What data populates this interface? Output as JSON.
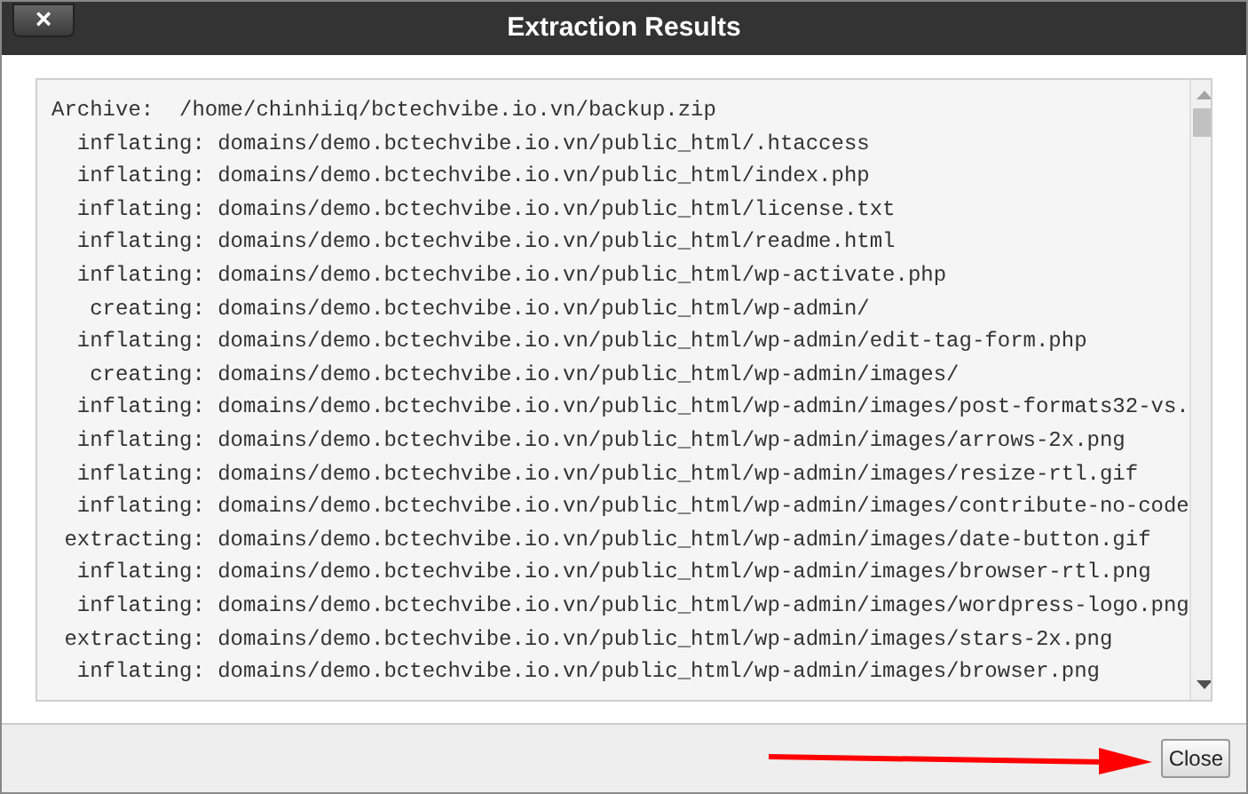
{
  "window": {
    "title": "Extraction Results",
    "close_glyph": "×"
  },
  "log": [
    {
      "kind": "archive",
      "label": "Archive:",
      "path": "/home/chinhiiq/bctechvibe.io.vn/backup.zip"
    },
    {
      "kind": "entry",
      "label": "inflating:",
      "path": "domains/demo.bctechvibe.io.vn/public_html/.htaccess"
    },
    {
      "kind": "entry",
      "label": "inflating:",
      "path": "domains/demo.bctechvibe.io.vn/public_html/index.php"
    },
    {
      "kind": "entry",
      "label": "inflating:",
      "path": "domains/demo.bctechvibe.io.vn/public_html/license.txt"
    },
    {
      "kind": "entry",
      "label": "inflating:",
      "path": "domains/demo.bctechvibe.io.vn/public_html/readme.html"
    },
    {
      "kind": "entry",
      "label": "inflating:",
      "path": "domains/demo.bctechvibe.io.vn/public_html/wp-activate.php"
    },
    {
      "kind": "entry",
      "label": "creating:",
      "path": "domains/demo.bctechvibe.io.vn/public_html/wp-admin/"
    },
    {
      "kind": "entry",
      "label": "inflating:",
      "path": "domains/demo.bctechvibe.io.vn/public_html/wp-admin/edit-tag-form.php"
    },
    {
      "kind": "entry",
      "label": "creating:",
      "path": "domains/demo.bctechvibe.io.vn/public_html/wp-admin/images/"
    },
    {
      "kind": "entry",
      "label": "inflating:",
      "path": "domains/demo.bctechvibe.io.vn/public_html/wp-admin/images/post-formats32-vs."
    },
    {
      "kind": "entry",
      "label": "inflating:",
      "path": "domains/demo.bctechvibe.io.vn/public_html/wp-admin/images/arrows-2x.png"
    },
    {
      "kind": "entry",
      "label": "inflating:",
      "path": "domains/demo.bctechvibe.io.vn/public_html/wp-admin/images/resize-rtl.gif"
    },
    {
      "kind": "entry",
      "label": "inflating:",
      "path": "domains/demo.bctechvibe.io.vn/public_html/wp-admin/images/contribute-no-code"
    },
    {
      "kind": "entry",
      "label": "extracting:",
      "path": "domains/demo.bctechvibe.io.vn/public_html/wp-admin/images/date-button.gif"
    },
    {
      "kind": "entry",
      "label": "inflating:",
      "path": "domains/demo.bctechvibe.io.vn/public_html/wp-admin/images/browser-rtl.png"
    },
    {
      "kind": "entry",
      "label": "inflating:",
      "path": "domains/demo.bctechvibe.io.vn/public_html/wp-admin/images/wordpress-logo.png"
    },
    {
      "kind": "entry",
      "label": "extracting:",
      "path": "domains/demo.bctechvibe.io.vn/public_html/wp-admin/images/stars-2x.png"
    },
    {
      "kind": "entry",
      "label": "inflating:",
      "path": "domains/demo.bctechvibe.io.vn/public_html/wp-admin/images/browser.png"
    }
  ],
  "footer": {
    "button": "Close"
  }
}
